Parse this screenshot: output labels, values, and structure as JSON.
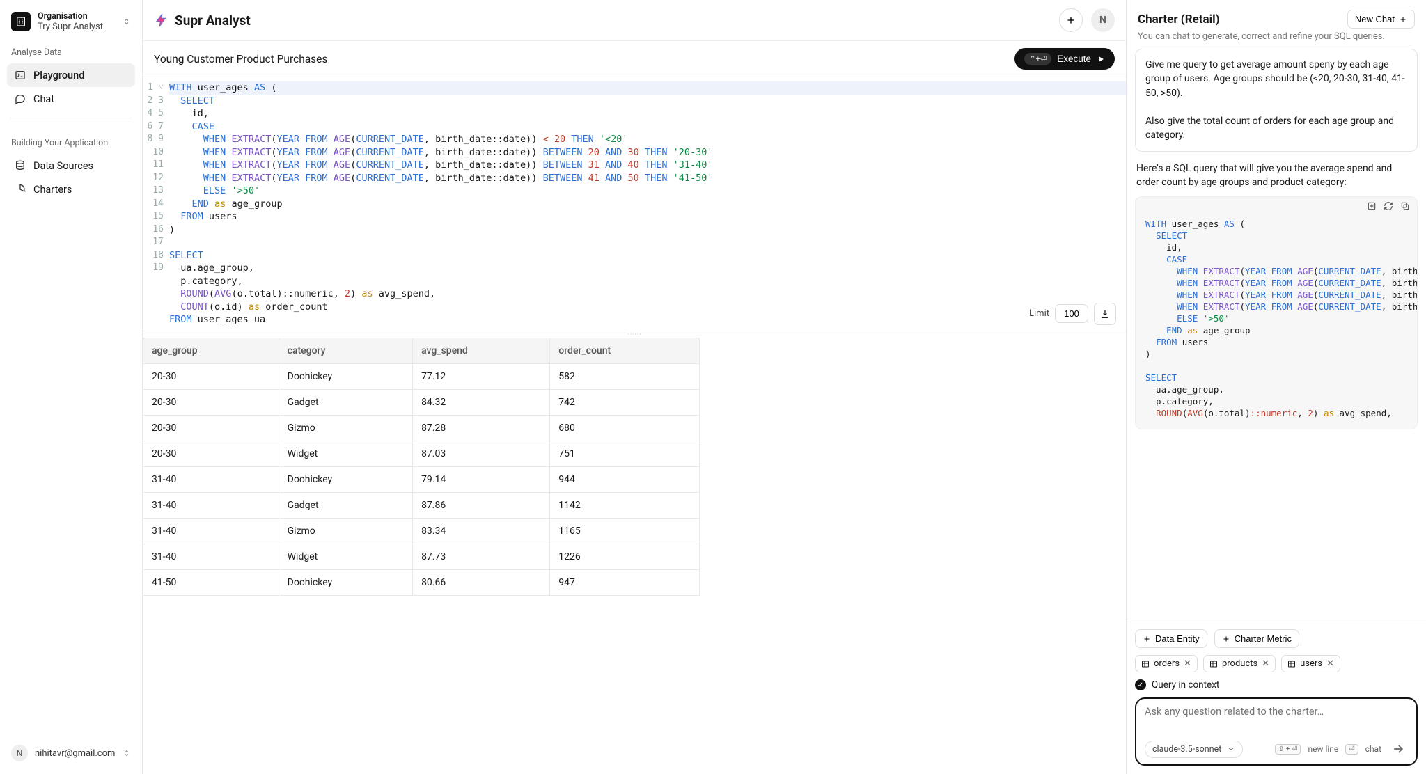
{
  "org": {
    "label": "Organisation",
    "name": "Try Supr Analyst"
  },
  "brand": "Supr Analyst",
  "nav": {
    "section1": "Analyse Data",
    "playground": "Playground",
    "chat": "Chat",
    "section2": "Building Your Application",
    "datasources": "Data Sources",
    "charters": "Charters"
  },
  "user": {
    "email": "nihitavr@gmail.com",
    "initial": "N"
  },
  "topbar": {
    "avatar_initial": "N"
  },
  "query": {
    "title": "Young Customer Product Purchases",
    "execute": "Execute",
    "kbd": "⌃+⏎",
    "limit_label": "Limit",
    "limit_value": "100"
  },
  "editor_lines": 19,
  "table": {
    "headers": [
      "age_group",
      "category",
      "avg_spend",
      "order_count"
    ],
    "rows": [
      [
        "20-30",
        "Doohickey",
        "77.12",
        "582"
      ],
      [
        "20-30",
        "Gadget",
        "84.32",
        "742"
      ],
      [
        "20-30",
        "Gizmo",
        "87.28",
        "680"
      ],
      [
        "20-30",
        "Widget",
        "87.03",
        "751"
      ],
      [
        "31-40",
        "Doohickey",
        "79.14",
        "944"
      ],
      [
        "31-40",
        "Gadget",
        "87.86",
        "1142"
      ],
      [
        "31-40",
        "Gizmo",
        "83.34",
        "1165"
      ],
      [
        "31-40",
        "Widget",
        "87.73",
        "1226"
      ],
      [
        "41-50",
        "Doohickey",
        "80.66",
        "947"
      ]
    ]
  },
  "chat": {
    "title": "Charter (Retail)",
    "new_chat": "New Chat",
    "subtitle": "You can chat to generate, correct and refine your SQL queries.",
    "user_msg": "Give me query to get average amount speny by each age group of users. Age groups should be (<20, 20-30, 31-40, 41-50, >50).\n\nAlso give the total count of orders for each age group and category.",
    "assist_msg": "Here's a SQL query that will give you the average spend and order count by age groups and product category:"
  },
  "composer": {
    "data_entity": "Data Entity",
    "charter_metric": "Charter Metric",
    "tags": [
      "orders",
      "products",
      "users"
    ],
    "context_label": "Query in context",
    "placeholder": "Ask any question related to the charter…",
    "model": "claude-3.5-sonnet",
    "hint_newline": "new line",
    "hint_chat": "chat",
    "kbd_newline": "⇧ + ⏎",
    "kbd_chat": "⏎"
  }
}
